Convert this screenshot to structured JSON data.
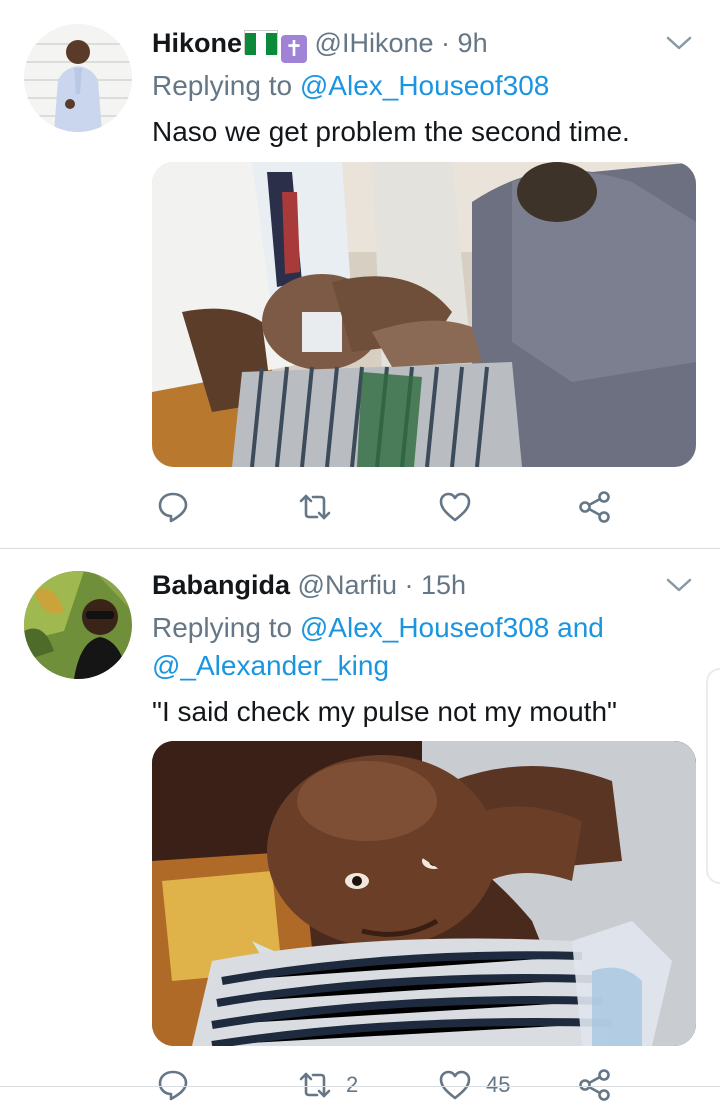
{
  "tweets": [
    {
      "name": "Hikone",
      "handle": "@IHikone",
      "dot": "·",
      "time": "9h",
      "replying_prefix": "Replying to",
      "mentions": [
        "@Alex_Houseof308"
      ],
      "text": "Naso we get problem the second time.",
      "flag_icon": "nigeria-flag-icon",
      "cross_icon": "latin-cross-icon",
      "cross_glyph": "✝",
      "actions": {
        "reply_count": "",
        "retweet_count": "",
        "like_count": ""
      }
    },
    {
      "name": "Babangida",
      "name_prefix_glyph": "",
      "name_suffix_glyph": "",
      "handle": "@Narfiu",
      "dot": "·",
      "time": "15h",
      "replying_prefix": "Replying to",
      "mentions": [
        "@Alex_Houseof308",
        "@_Alexander_king"
      ],
      "joiner": "and",
      "text": "\"I said check my pulse not my mouth\"",
      "actions": {
        "reply_count": "",
        "retweet_count": "2",
        "like_count": "45"
      }
    }
  ],
  "colors": {
    "link": "#1b95e0",
    "secondary": "#657786",
    "primary_text": "#14171a",
    "divider": "#d8dde1"
  }
}
